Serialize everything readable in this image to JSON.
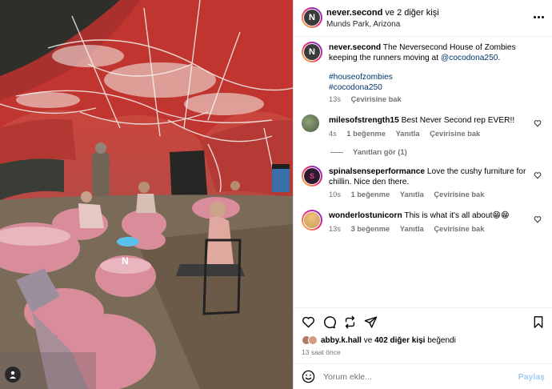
{
  "post": {
    "author": "never.second",
    "coauthor_text": "ve 2 diğer kişi",
    "location": "Munds Park, Arizona",
    "caption_prefix": "The Neversecond House of Zombies keeping the runners moving at",
    "caption_mention": "@cocodona250",
    "caption_suffix": ".",
    "hashtag1": "#houseofzombies",
    "hashtag2": "#cocodona250",
    "time": "13s",
    "translate": "Çevirisine bak"
  },
  "comments": [
    {
      "user": "milesofstrength15",
      "text": "Best Never Second rep EVER!!",
      "time": "4s",
      "likes": "1 beğenme",
      "reply": "Yanıtla",
      "translate": "Çevirisine bak"
    },
    {
      "user": "spinalsenseperformance",
      "text": "Love the cushy furniture for chillin. Nice den there.",
      "time": "10s",
      "likes": "1 beğenme",
      "reply": "Yanıtla",
      "translate": "Çevirisine bak"
    },
    {
      "user": "wonderlostunicorn",
      "text": "This is what it's all about😁😁",
      "time": "13s",
      "likes": "3 beğenme",
      "reply": "Yanıtla",
      "translate": "Çevirisine bak"
    }
  ],
  "view_replies": "Yanıtları gör (1)",
  "likes_user": "abby.k.hall",
  "likes_mid": "ve",
  "likes_others": "402 diğer kişi",
  "likes_suffix": "beğendi",
  "post_time": "13 saat önce",
  "add_comment_placeholder": "Yorum ekle...",
  "share_label": "Paylaş",
  "brand_letter": "N",
  "icons": [
    "more-icon",
    "heart-icon",
    "comment-icon",
    "repost-icon",
    "share-icon",
    "bookmark-icon",
    "emoji-icon",
    "user-tag-icon"
  ],
  "colors": {
    "link": "#00376b",
    "meta": "#737373",
    "share_disabled": "#9fc9f3",
    "tent_red": "#c9463d"
  }
}
